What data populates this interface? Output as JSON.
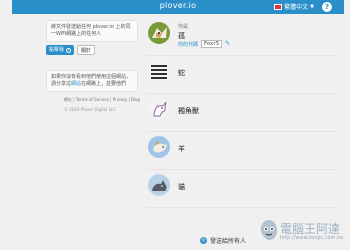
{
  "topbar": {
    "brand": "plover.io",
    "language": "繁體中文",
    "help_icon": "?"
  },
  "promo": {
    "text": "將文件發送給任何 plover.io 上的同一WiFi網路上的任何人",
    "primary_label": "點擊我",
    "secondary_label": "關於"
  },
  "note": {
    "text_before": "如果你沒有看到他們使用這個網站，請分享這",
    "link": "網站",
    "text_after": "在網路上，並要他們"
  },
  "footer": {
    "row1": "網址 | Terms of Service | Privacy | Blog",
    "row2": "© 2019 Plover Digital LLC"
  },
  "me": {
    "label": "你是",
    "name": "孤",
    "code_label": "你的代碼",
    "code": "Foxr5"
  },
  "peers": [
    {
      "name": "蛇"
    },
    {
      "name": "獨角獸"
    },
    {
      "name": "羊"
    },
    {
      "name": "貓"
    }
  ],
  "send_all": "發送給所有人",
  "watermark": {
    "title": "電腦王阿達",
    "url": "http://www.kocpc.com.tw"
  },
  "colors": {
    "accent": "#2a8fc9"
  }
}
